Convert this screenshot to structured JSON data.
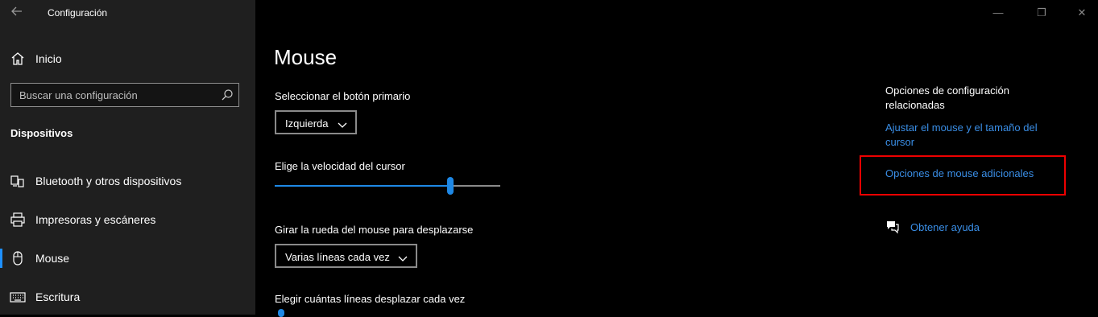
{
  "window": {
    "title": "Configuración",
    "controls": {
      "minimize": "—",
      "restore": "❐",
      "close": "✕"
    }
  },
  "sidebar": {
    "home": "Inicio",
    "search_placeholder": "Buscar una configuración",
    "section": "Dispositivos",
    "items": [
      {
        "label": "Bluetooth y otros dispositivos",
        "icon": "bluetooth-devices-icon"
      },
      {
        "label": "Impresoras y escáneres",
        "icon": "printer-icon"
      },
      {
        "label": "Mouse",
        "icon": "mouse-icon",
        "active": true
      },
      {
        "label": "Escritura",
        "icon": "keyboard-icon"
      }
    ]
  },
  "main": {
    "title": "Mouse",
    "primary_button": {
      "label": "Seleccionar el botón primario",
      "value": "Izquierda"
    },
    "cursor_speed": {
      "label": "Elige la velocidad del cursor",
      "value_fraction": 0.78
    },
    "scroll_wheel": {
      "label": "Girar la rueda del mouse para desplazarse",
      "value": "Varias líneas cada vez"
    },
    "lines_to_scroll": {
      "label": "Elegir cuántas líneas desplazar cada vez"
    }
  },
  "related": {
    "title": "Opciones de configuración relacionadas",
    "links": {
      "adjust_size": "Ajustar el mouse y el tamaño del cursor",
      "additional_options": "Opciones de mouse adicionales"
    },
    "help": "Obtener ayuda"
  },
  "colors": {
    "accent": "#1e88e5",
    "link": "#3a8ee6",
    "highlight": "#e00000",
    "sidebar_bg": "#1f1f1f"
  }
}
